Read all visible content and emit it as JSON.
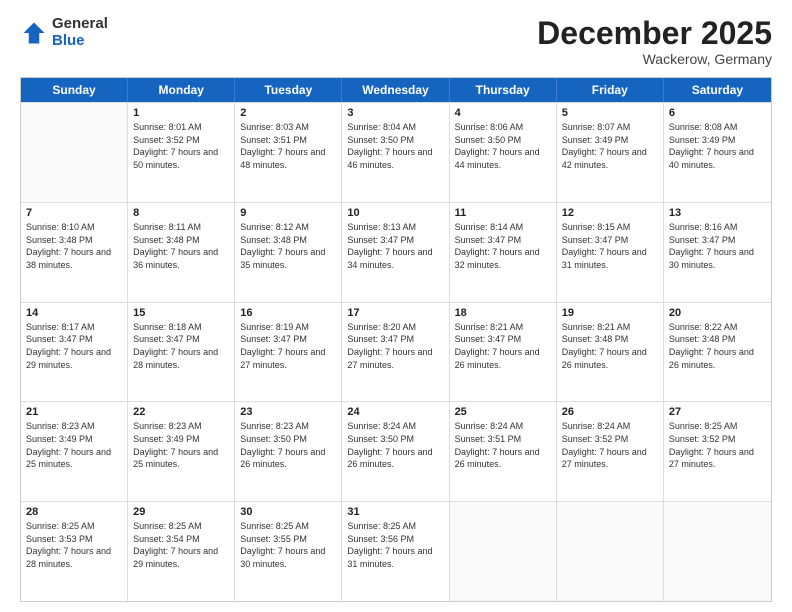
{
  "logo": {
    "general": "General",
    "blue": "Blue"
  },
  "title": "December 2025",
  "subtitle": "Wackerow, Germany",
  "days": [
    "Sunday",
    "Monday",
    "Tuesday",
    "Wednesday",
    "Thursday",
    "Friday",
    "Saturday"
  ],
  "weeks": [
    [
      {
        "day": "",
        "sunrise": "",
        "sunset": "",
        "daylight": ""
      },
      {
        "day": "1",
        "sunrise": "Sunrise: 8:01 AM",
        "sunset": "Sunset: 3:52 PM",
        "daylight": "Daylight: 7 hours and 50 minutes."
      },
      {
        "day": "2",
        "sunrise": "Sunrise: 8:03 AM",
        "sunset": "Sunset: 3:51 PM",
        "daylight": "Daylight: 7 hours and 48 minutes."
      },
      {
        "day": "3",
        "sunrise": "Sunrise: 8:04 AM",
        "sunset": "Sunset: 3:50 PM",
        "daylight": "Daylight: 7 hours and 46 minutes."
      },
      {
        "day": "4",
        "sunrise": "Sunrise: 8:06 AM",
        "sunset": "Sunset: 3:50 PM",
        "daylight": "Daylight: 7 hours and 44 minutes."
      },
      {
        "day": "5",
        "sunrise": "Sunrise: 8:07 AM",
        "sunset": "Sunset: 3:49 PM",
        "daylight": "Daylight: 7 hours and 42 minutes."
      },
      {
        "day": "6",
        "sunrise": "Sunrise: 8:08 AM",
        "sunset": "Sunset: 3:49 PM",
        "daylight": "Daylight: 7 hours and 40 minutes."
      }
    ],
    [
      {
        "day": "7",
        "sunrise": "Sunrise: 8:10 AM",
        "sunset": "Sunset: 3:48 PM",
        "daylight": "Daylight: 7 hours and 38 minutes."
      },
      {
        "day": "8",
        "sunrise": "Sunrise: 8:11 AM",
        "sunset": "Sunset: 3:48 PM",
        "daylight": "Daylight: 7 hours and 36 minutes."
      },
      {
        "day": "9",
        "sunrise": "Sunrise: 8:12 AM",
        "sunset": "Sunset: 3:48 PM",
        "daylight": "Daylight: 7 hours and 35 minutes."
      },
      {
        "day": "10",
        "sunrise": "Sunrise: 8:13 AM",
        "sunset": "Sunset: 3:47 PM",
        "daylight": "Daylight: 7 hours and 34 minutes."
      },
      {
        "day": "11",
        "sunrise": "Sunrise: 8:14 AM",
        "sunset": "Sunset: 3:47 PM",
        "daylight": "Daylight: 7 hours and 32 minutes."
      },
      {
        "day": "12",
        "sunrise": "Sunrise: 8:15 AM",
        "sunset": "Sunset: 3:47 PM",
        "daylight": "Daylight: 7 hours and 31 minutes."
      },
      {
        "day": "13",
        "sunrise": "Sunrise: 8:16 AM",
        "sunset": "Sunset: 3:47 PM",
        "daylight": "Daylight: 7 hours and 30 minutes."
      }
    ],
    [
      {
        "day": "14",
        "sunrise": "Sunrise: 8:17 AM",
        "sunset": "Sunset: 3:47 PM",
        "daylight": "Daylight: 7 hours and 29 minutes."
      },
      {
        "day": "15",
        "sunrise": "Sunrise: 8:18 AM",
        "sunset": "Sunset: 3:47 PM",
        "daylight": "Daylight: 7 hours and 28 minutes."
      },
      {
        "day": "16",
        "sunrise": "Sunrise: 8:19 AM",
        "sunset": "Sunset: 3:47 PM",
        "daylight": "Daylight: 7 hours and 27 minutes."
      },
      {
        "day": "17",
        "sunrise": "Sunrise: 8:20 AM",
        "sunset": "Sunset: 3:47 PM",
        "daylight": "Daylight: 7 hours and 27 minutes."
      },
      {
        "day": "18",
        "sunrise": "Sunrise: 8:21 AM",
        "sunset": "Sunset: 3:47 PM",
        "daylight": "Daylight: 7 hours and 26 minutes."
      },
      {
        "day": "19",
        "sunrise": "Sunrise: 8:21 AM",
        "sunset": "Sunset: 3:48 PM",
        "daylight": "Daylight: 7 hours and 26 minutes."
      },
      {
        "day": "20",
        "sunrise": "Sunrise: 8:22 AM",
        "sunset": "Sunset: 3:48 PM",
        "daylight": "Daylight: 7 hours and 26 minutes."
      }
    ],
    [
      {
        "day": "21",
        "sunrise": "Sunrise: 8:23 AM",
        "sunset": "Sunset: 3:49 PM",
        "daylight": "Daylight: 7 hours and 25 minutes."
      },
      {
        "day": "22",
        "sunrise": "Sunrise: 8:23 AM",
        "sunset": "Sunset: 3:49 PM",
        "daylight": "Daylight: 7 hours and 25 minutes."
      },
      {
        "day": "23",
        "sunrise": "Sunrise: 8:23 AM",
        "sunset": "Sunset: 3:50 PM",
        "daylight": "Daylight: 7 hours and 26 minutes."
      },
      {
        "day": "24",
        "sunrise": "Sunrise: 8:24 AM",
        "sunset": "Sunset: 3:50 PM",
        "daylight": "Daylight: 7 hours and 26 minutes."
      },
      {
        "day": "25",
        "sunrise": "Sunrise: 8:24 AM",
        "sunset": "Sunset: 3:51 PM",
        "daylight": "Daylight: 7 hours and 26 minutes."
      },
      {
        "day": "26",
        "sunrise": "Sunrise: 8:24 AM",
        "sunset": "Sunset: 3:52 PM",
        "daylight": "Daylight: 7 hours and 27 minutes."
      },
      {
        "day": "27",
        "sunrise": "Sunrise: 8:25 AM",
        "sunset": "Sunset: 3:52 PM",
        "daylight": "Daylight: 7 hours and 27 minutes."
      }
    ],
    [
      {
        "day": "28",
        "sunrise": "Sunrise: 8:25 AM",
        "sunset": "Sunset: 3:53 PM",
        "daylight": "Daylight: 7 hours and 28 minutes."
      },
      {
        "day": "29",
        "sunrise": "Sunrise: 8:25 AM",
        "sunset": "Sunset: 3:54 PM",
        "daylight": "Daylight: 7 hours and 29 minutes."
      },
      {
        "day": "30",
        "sunrise": "Sunrise: 8:25 AM",
        "sunset": "Sunset: 3:55 PM",
        "daylight": "Daylight: 7 hours and 30 minutes."
      },
      {
        "day": "31",
        "sunrise": "Sunrise: 8:25 AM",
        "sunset": "Sunset: 3:56 PM",
        "daylight": "Daylight: 7 hours and 31 minutes."
      },
      {
        "day": "",
        "sunrise": "",
        "sunset": "",
        "daylight": ""
      },
      {
        "day": "",
        "sunrise": "",
        "sunset": "",
        "daylight": ""
      },
      {
        "day": "",
        "sunrise": "",
        "sunset": "",
        "daylight": ""
      }
    ]
  ]
}
